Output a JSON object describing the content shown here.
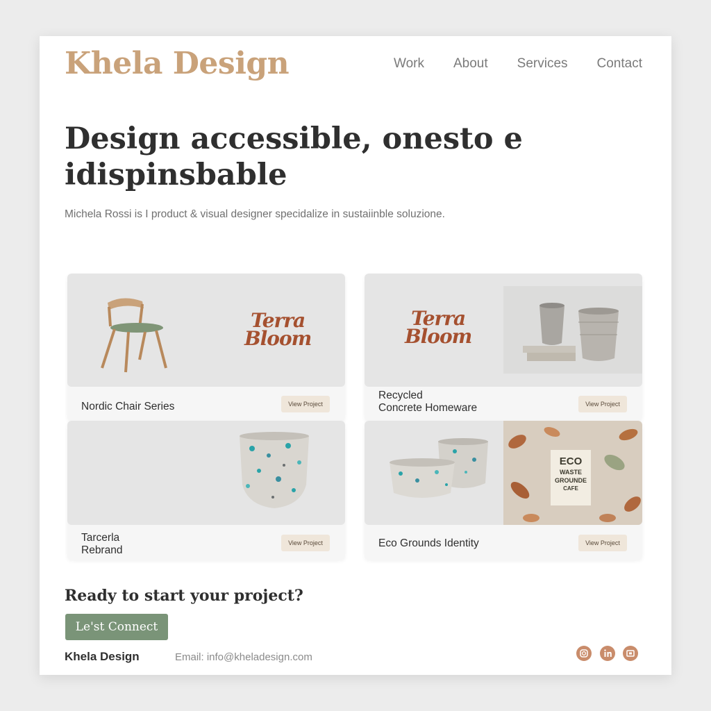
{
  "brand": {
    "name": "Khela Design"
  },
  "nav": {
    "items": [
      "Work",
      "About",
      "Services",
      "Contact"
    ]
  },
  "hero": {
    "title_line1": "Design accessible, onesto e",
    "title_line2": "idispinsbable",
    "subtitle": "Michela Rossi is I product & visual designer specidalize in sustaiinble soluzione."
  },
  "projects": [
    {
      "title_lines": [
        "Nordic Chair Series"
      ],
      "button": "View Project",
      "logo_line1": "Terra",
      "logo_line2": "Bloom"
    },
    {
      "title_lines": [
        "Recycled",
        "Concrete Homeware"
      ],
      "button": "View Project",
      "logo_line1": "Terra",
      "logo_line2": "Bloom"
    },
    {
      "title_lines": [
        "Tarcerla",
        "Rebrand"
      ],
      "button": "View Project"
    },
    {
      "title_lines": [
        "Eco Grounds Identity"
      ],
      "button": "View Project",
      "poster_lines": [
        "ECO",
        "WASTE",
        "GROUNDE",
        "CAFE"
      ]
    }
  ],
  "cta": {
    "title": "Ready to start your project?",
    "button": "Le'st Connect"
  },
  "footer": {
    "brand": "Khela Design",
    "email": "Email: info@kheladesign.com",
    "social_icons": [
      "instagram-icon",
      "linkedin-icon",
      "behance-icon"
    ]
  },
  "colors": {
    "accent": "#c9a27a",
    "cta": "#7a9478",
    "terracotta": "#a5502f",
    "social": "#c98c6b"
  }
}
